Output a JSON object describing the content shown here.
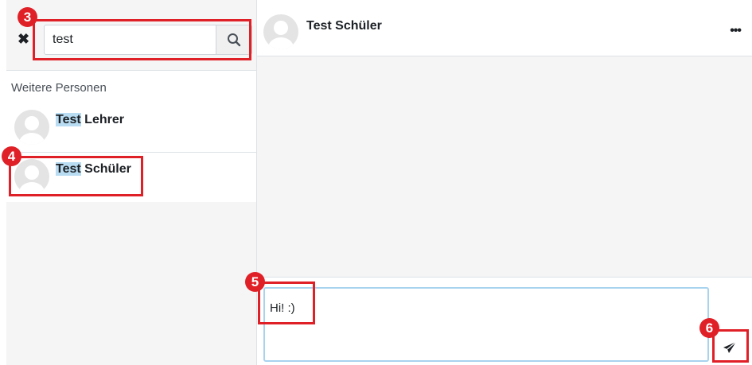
{
  "search": {
    "value": "test"
  },
  "sidebar": {
    "section_title": "Weitere Personen",
    "contacts": [
      {
        "highlight": "Test",
        "rest": " Lehrer"
      },
      {
        "highlight": "Test",
        "rest": " Schüler"
      }
    ]
  },
  "chat": {
    "name": "Test Schüler",
    "menu": "•••",
    "message": "Hi! :)"
  },
  "annotations": [
    "3",
    "4",
    "5",
    "6"
  ],
  "colors": {
    "annotation": "#e02027",
    "highlight": "#b8dcf2"
  },
  "icons": {
    "close": "close-icon",
    "search": "search-icon",
    "send": "send-icon",
    "menu": "more-icon"
  }
}
